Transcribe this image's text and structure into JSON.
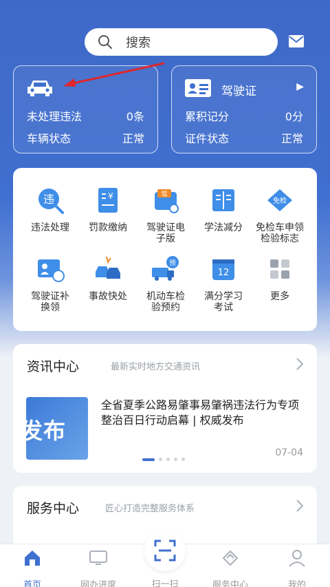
{
  "search": {
    "placeholder": "搜索"
  },
  "violations_card": {
    "rows": [
      {
        "label": "未处理违法",
        "value": "0",
        "unit": "条"
      },
      {
        "label": "车辆状态",
        "value": "正常"
      }
    ]
  },
  "license_card": {
    "title": "驾驶证",
    "rows": [
      {
        "label": "累积记分",
        "value": "0",
        "unit": "分"
      },
      {
        "label": "证件状态",
        "value": "正常"
      }
    ]
  },
  "services": [
    {
      "label": "违法处理",
      "icon": "magnifier-violation-icon"
    },
    {
      "label": "罚款缴纳",
      "icon": "receipt-yen-icon"
    },
    {
      "label": "驾驶证电\n子版",
      "icon": "wallet-license-icon"
    },
    {
      "label": "学法减分",
      "icon": "book-icon"
    },
    {
      "label": "免检车申领\n检验标志",
      "icon": "exempt-badge-icon"
    },
    {
      "label": "驾驶证补\n换领",
      "icon": "license-swap-icon"
    },
    {
      "label": "事故快处",
      "icon": "accident-cars-icon"
    },
    {
      "label": "机动车检\n验预约",
      "icon": "truck-appointment-icon"
    },
    {
      "label": "满分学习\n考试",
      "icon": "calendar-12-icon"
    },
    {
      "label": "更多",
      "icon": "more-grid-icon"
    }
  ],
  "news": {
    "title": "资讯中心",
    "subtitle": "最新实时地方交通资讯",
    "thumb_text": "发布",
    "headline": "全省夏季公路易肇事易肇祸违法行为专项整治百日行动启幕 | 权威发布",
    "date": "07-04"
  },
  "service_center": {
    "title": "服务中心",
    "subtitle": "匠心打造完整服务体系"
  },
  "tabs": [
    {
      "label": "首页",
      "icon": "home-icon",
      "active": true
    },
    {
      "label": "网办进度",
      "icon": "monitor-icon",
      "active": false
    },
    {
      "label": "扫一扫",
      "icon": "scan-icon",
      "active": false
    },
    {
      "label": "服务中心",
      "icon": "handshake-icon",
      "active": false
    },
    {
      "label": "我的",
      "icon": "user-icon",
      "active": false
    }
  ],
  "colors": {
    "primary": "#3f6fd0",
    "accent_orange": "#f08a2a",
    "annotation_red": "#e0262a"
  }
}
